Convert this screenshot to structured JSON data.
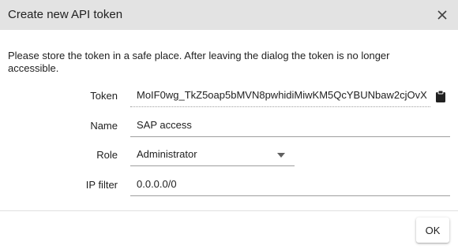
{
  "dialog": {
    "title": "Create new API token",
    "close_icon": "close-icon",
    "notice": "Please store the token in a safe place. After leaving the dialog the token is no longer accessible."
  },
  "form": {
    "token": {
      "label": "Token",
      "value": "MoIF0wg_TkZ5oap5bMVN8pwhidiMiwKM5QcYBUNbaw2cjOvX",
      "copy_icon": "clipboard-icon"
    },
    "name": {
      "label": "Name",
      "value": "SAP access"
    },
    "role": {
      "label": "Role",
      "value": "Administrator",
      "arrow_icon": "caret-down-icon"
    },
    "ip_filter": {
      "label": "IP filter",
      "value": "0.0.0.0/0"
    }
  },
  "footer": {
    "ok_label": "OK"
  }
}
